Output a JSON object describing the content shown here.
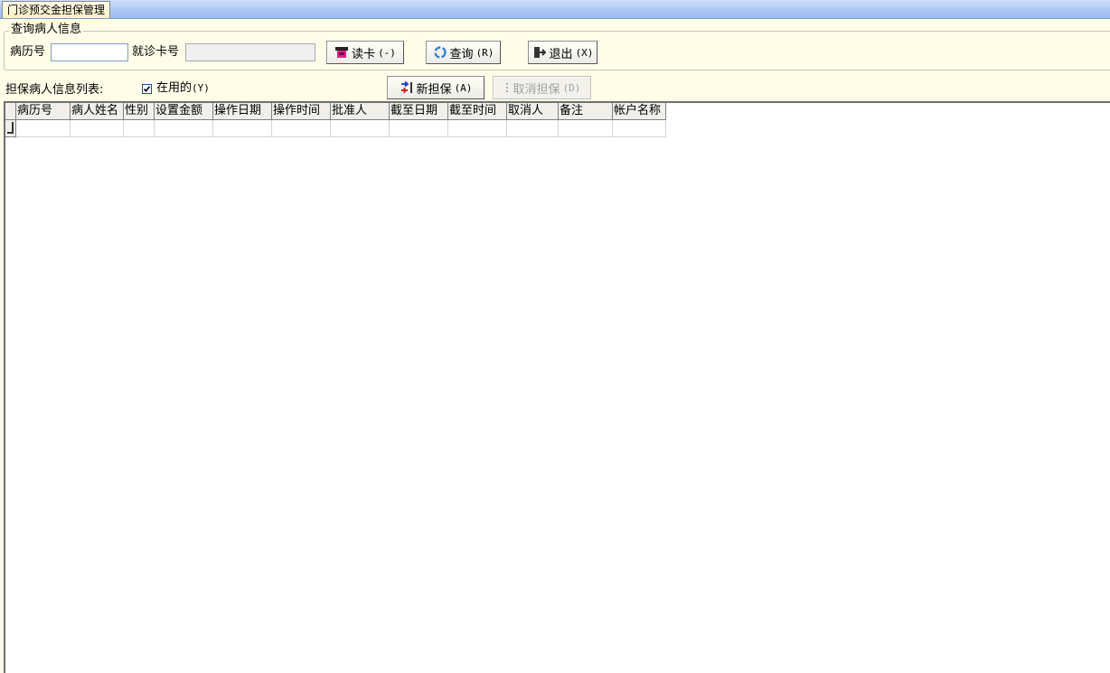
{
  "tab": {
    "title": "门诊预交金担保管理"
  },
  "query": {
    "group_title": "查询病人信息",
    "record_label": "病历号",
    "record_value": "",
    "card_label": "就诊卡号",
    "card_value": "",
    "read_card_button": {
      "label": "读卡",
      "hotkey": "(-)"
    },
    "search_button": {
      "label": "查询",
      "hotkey": "(R)"
    },
    "exit_button": {
      "label": "退出",
      "hotkey": "(X)"
    }
  },
  "list": {
    "title": "担保病人信息列表:",
    "active_checkbox": {
      "label": "在用的",
      "hotkey": "(Y)",
      "checked": true
    },
    "new_button": {
      "label": "新担保",
      "hotkey": "(A)"
    },
    "cancel_button": {
      "label": "取消担保",
      "hotkey": "(D)",
      "disabled": true
    }
  },
  "grid": {
    "columns": [
      "病历号",
      "病人姓名",
      "性别",
      "设置金额",
      "操作日期",
      "操作时间",
      "批准人",
      "截至日期",
      "截至时间",
      "取消人",
      "备注",
      "帐户名称"
    ],
    "rows": [
      [
        "",
        "",
        "",
        "",
        "",
        "",
        "",
        "",
        "",
        "",
        "",
        ""
      ]
    ]
  },
  "colors": {
    "panel_bg": "#fffde8",
    "tab_strip": "#a9c5f3",
    "grid_header": "#f0efe9"
  }
}
